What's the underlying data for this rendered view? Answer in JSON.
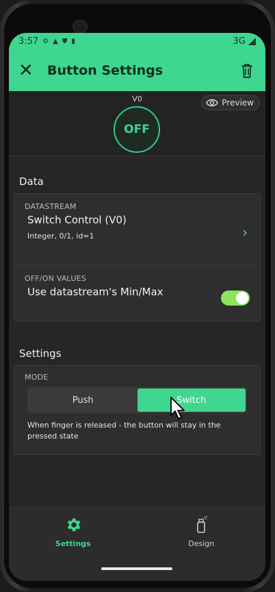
{
  "status_bar": {
    "time": "3:57",
    "network": "3G"
  },
  "app_bar": {
    "title": "Button Settings"
  },
  "preview": {
    "pin_label": "V0",
    "preview_label": "Preview",
    "button_state": "OFF"
  },
  "data_section": {
    "title": "Data",
    "datastream_label": "DATASTREAM",
    "datastream_name": "Switch Control (V0)",
    "datastream_info": "Integer, 0/1, id=1",
    "values_label": "OFF/ON VALUES",
    "values_text": "Use datastream's Min/Max",
    "values_toggle_on": true
  },
  "settings_section": {
    "title": "Settings",
    "mode_label": "MODE",
    "mode_options": [
      "Push",
      "Switch"
    ],
    "selected_mode": "Switch",
    "mode_description": "When finger is released - the button will stay in the pressed state"
  },
  "bottom_nav": {
    "settings_label": "Settings",
    "design_label": "Design"
  },
  "colors": {
    "accent": "#3fd68f",
    "toggle_on": "#8be45a",
    "background": "#262626"
  }
}
